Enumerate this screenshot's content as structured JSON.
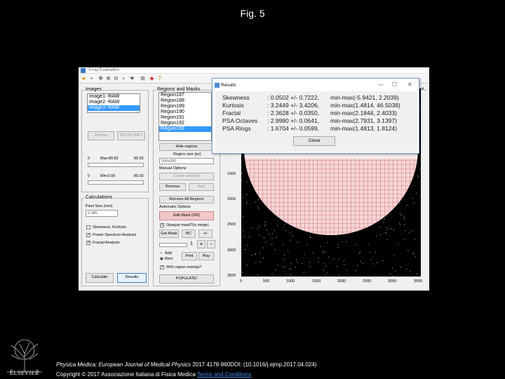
{
  "slide": {
    "title": "Fig. 5"
  },
  "app": {
    "window_title": "X-ray Evaluation",
    "images_panel": {
      "label": "Images",
      "items": [
        "image1 -RAW",
        "image2 -RAW",
        "image3 -RAW"
      ],
      "selected_index": 2,
      "reload_label": "Reload",
      "dicom_label": "DICOM INFO",
      "max_min": {
        "a": "0",
        "max": "Max:89.82",
        "b": "89.92",
        "c": "0",
        "min": "Min:0.09",
        "d": "89.92"
      }
    },
    "regions_panel": {
      "label": "Regions and Masks",
      "items": [
        "Region187",
        "Region188",
        "Region189",
        "Region190",
        "Region191",
        "Region192",
        "Region193"
      ],
      "selected_index": 6,
      "hide_regions_label": "Hide regions",
      "region_size_label": "Region size (px)",
      "region_size_value": "200x200",
      "manual_options_label": "Manual Options",
      "create_selector_label": "Create selector",
      "remove_label": "Remove",
      "add_label": "Add",
      "remove_all_label": "Remove All Regions",
      "automatic_options_label": "Automatic Options",
      "edit_mask_label": "Edit Mask (ON)",
      "opaque_mask_label": "Opaque mask?(is range)",
      "get_mask_label": "Get Mask",
      "bc_label": "BC",
      "plus_minus_label": "+/-",
      "stepper_value": "1",
      "plus_label": "+",
      "minus_label": "-",
      "add_radio_label": "Add",
      "rem_radio_label": "Rem",
      "print_label": "Print",
      "play_label": "Play",
      "overlap_label": "50% region overlap?",
      "populate_label": "POPULATE!"
    },
    "calculations_panel": {
      "label": "Calculations",
      "pixel_size_label": "Pixel Size (mm)",
      "pixel_size_value": "0.385",
      "options": [
        {
          "label": "Skewness, Kurtosis",
          "checked": false
        },
        {
          "label": "Power Spectrum Analysis",
          "checked": true
        },
        {
          "label": "Fractal Analysis",
          "checked": true
        }
      ],
      "calculate_label": "Calculate",
      "results_label": "Results"
    },
    "plot": {
      "y_ticks": [
        "1500",
        "2000",
        "2500",
        "3000",
        "3500"
      ],
      "x_ticks": [
        "0",
        "500",
        "1000",
        "1500",
        "2000",
        "2500",
        "3000",
        "3500"
      ],
      "corner_label": "al_"
    },
    "results_dialog": {
      "title": "Results",
      "min_label": "—",
      "max_label": "☐",
      "close_x_label": "✕",
      "rows": [
        {
          "name": "Skewness",
          "value": ": 0.0502 +/- 0.7222,",
          "range": "min-max(-5.9421, 2.2039)"
        },
        {
          "name": "Kurtosis",
          "value": ": 3.2449 +/- 3.4206,",
          "range": "min-max(1.4814, 46.5038)"
        },
        {
          "name": "Fractal",
          "value": ": 2.3628 +/- 0.0350,",
          "range": "min-max(2.1844, 2.4033)"
        },
        {
          "name": "PSA Octaves",
          "value": ": 2.9980 +/- 0.0641,",
          "range": "min-max(2.7931, 3.1397)"
        },
        {
          "name": "PSA Rings",
          "value": ": 1.6704 +/- 0.0599,",
          "range": "min-max(1.4813, 1.8124)"
        }
      ],
      "close_label": "Close"
    }
  },
  "footer": {
    "publisher": "ELSEVIER",
    "journal": "Physica Medica: European Journal of Medical Physics",
    "citation": " 2017 4178-960DOI: (10.1016/j.ejmp.2017.04.024)",
    "copyright": "Copyright © 2017 Associazione Italiana di Fisica Medica",
    "terms_link": "Terms and Conditions"
  },
  "colors": {
    "selection": "#3399ff",
    "mask_red": "#cc2222",
    "link": "#4a8df0"
  }
}
